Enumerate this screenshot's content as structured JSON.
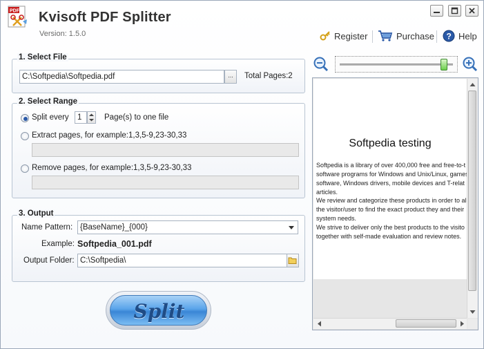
{
  "window": {
    "title": "Kvisoft PDF Splitter",
    "version": "Version: 1.5.0",
    "logo_badge": "PDF"
  },
  "toolbar": {
    "register": "Register",
    "purchase": "Purchase",
    "help": "Help"
  },
  "select_file": {
    "title": "1. Select File",
    "file_path": "C:\\Softpedia\\Softpedia.pdf",
    "browse_label": "...",
    "total_pages": "Total Pages:2"
  },
  "select_range": {
    "title": "2. Select Range",
    "split_every_label": "Split every",
    "split_every_value": "1",
    "split_every_suffix": "Page(s) to one file",
    "extract_label": "Extract pages,  for example:1,3,5-9,23-30,33",
    "extract_value": "",
    "remove_label": "Remove pages,  for example:1,3,5-9,23-30,33",
    "remove_value": "",
    "selected": "split_every"
  },
  "output": {
    "title": "3. Output",
    "name_pattern_label": "Name Pattern:",
    "name_pattern_value": "{BaseName}_{000}",
    "example_label": "Example:",
    "example_value": "Softpedia_001.pdf",
    "folder_label": "Output Folder:",
    "folder_value": "C:\\Softpedia\\"
  },
  "split_button": "Split",
  "preview": {
    "zoom_level": 0.95,
    "doc_title": "Softpedia testing",
    "lines": [
      "Softpedia is a library of over 400,000 free and free-to-t",
      "software programs for Windows and Unix/Linux, games",
      "software, Windows drivers, mobile devices and  T-relat",
      "articles.",
      "We review and categorize these products in order to al",
      "the visitor/user to find the exact product they and their",
      "system needs.",
      "We strive to deliver only the best products to the visito",
      "together with self-made evaluation and review notes."
    ]
  },
  "colors": {
    "accent": "#3a86d6",
    "panel_border": "#b8c4d2",
    "title_text": "#333333"
  }
}
